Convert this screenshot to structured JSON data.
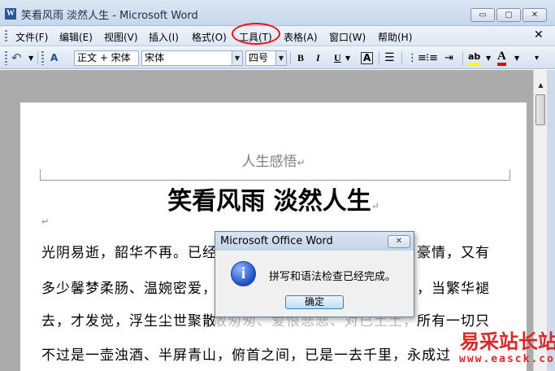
{
  "window": {
    "title": "笑看风雨 淡然人生 - Microsoft Word",
    "app_icon": "W",
    "minimize_icon": "▭",
    "maximize_icon": "▢",
    "close_icon": "✕"
  },
  "menu": {
    "items": [
      "文件(F)",
      "编辑(E)",
      "视图(V)",
      "插入(I)",
      "格式(O)",
      "工具(T)",
      "表格(A)",
      "窗口(W)",
      "帮助(H)"
    ],
    "highlighted": "工具(T)",
    "highlight_color": "#e11111",
    "close_icon": "✕"
  },
  "toolbar": {
    "undo_icon": "↶",
    "style_value": "正文 + 宋体",
    "font_value": "宋体",
    "size_value": "四号",
    "bold": "B",
    "italic": "I",
    "underline": "U",
    "char_border": "A",
    "highlight_letter": "ab",
    "font_color_letter": "A",
    "highlight_color": "#ffff00",
    "font_color": "#e00000"
  },
  "document": {
    "header_text": "人生感悟",
    "title": "笑看风雨  淡然人生",
    "paragraph_mark": "↵",
    "lines": [
      "光阴易逝，韶华不再。已经",
      "多少馨梦柔肠、温婉密爱，",
      "去，才发觉，浮生尘世聚散",
      "不过是一壶浊酒、半屏青山，俯首之间，已是一去千里，永成过"
    ],
    "lines_right": [
      "豪情，又有",
      "，当繁华褪",
      "所有一切只"
    ],
    "mid_fragment": "散匆匆、爱恨悲悲、对已土土，"
  },
  "dialog": {
    "title": "Microsoft Office Word",
    "close_icon": "✕",
    "info_icon": "i",
    "message": "拼写和语法检查已经完成。",
    "ok_label": "确定"
  },
  "watermark": {
    "text": "易采站长站",
    "url": "www.easck.com",
    "color": "#d42a2a"
  }
}
